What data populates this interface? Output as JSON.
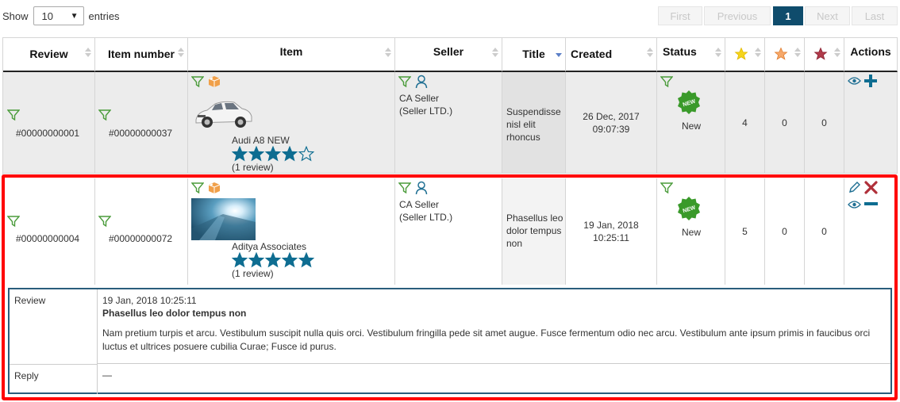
{
  "length_menu": {
    "show_label": "Show",
    "selected": "10",
    "entries_label": "entries"
  },
  "pagination": {
    "first": "First",
    "previous": "Previous",
    "current": "1",
    "next": "Next",
    "last": "Last"
  },
  "columns": {
    "review": "Review",
    "item_number": "Item number",
    "item": "Item",
    "seller": "Seller",
    "title": "Title",
    "created": "Created",
    "status": "Status",
    "actions": "Actions"
  },
  "rows": [
    {
      "review": "#00000000001",
      "item_number": "#00000000037",
      "item_name": "Audi A8 NEW",
      "rating": 4,
      "reviews_count": "(1 review)",
      "seller_name": "CA Seller",
      "seller_company": "(Seller LTD.)",
      "title": "Suspendisse nisl elit rhoncus",
      "created_date": "26 Dec, 2017",
      "created_time": "09:07:39",
      "status_badge": "NEW",
      "status": "New",
      "stars_gold": "4",
      "stars_orange": "0",
      "stars_red": "0"
    },
    {
      "review": "#00000000004",
      "item_number": "#00000000072",
      "item_name": "Aditya Associates",
      "rating": 5,
      "reviews_count": "(1 review)",
      "seller_name": "CA Seller",
      "seller_company": "(Seller LTD.)",
      "title": "Phasellus leo dolor tempus non",
      "created_date": "19 Jan, 2018",
      "created_time": "10:25:11",
      "status_badge": "NEW",
      "status": "New",
      "stars_gold": "5",
      "stars_orange": "0",
      "stars_red": "0"
    }
  ],
  "detail": {
    "review_label": "Review",
    "date": "19 Jan, 2018 10:25:11",
    "title": "Phasellus leo dolor tempus non",
    "body": "Nam pretium turpis et arcu. Vestibulum suscipit nulla quis orci. Vestibulum fringilla pede sit amet augue. Fusce fermentum odio nec arcu. Vestibulum ante ipsum primis in faucibus orci luctus et ultrices posuere cubilia Curae; Fusce id purus.",
    "reply_label": "Reply",
    "reply": "—"
  },
  "colors": {
    "accent": "#0f4c6c",
    "star": "#0e6d91",
    "filter": "#4a9b3a",
    "highlight": "#ff0000",
    "badge": "#3a9a2a"
  }
}
